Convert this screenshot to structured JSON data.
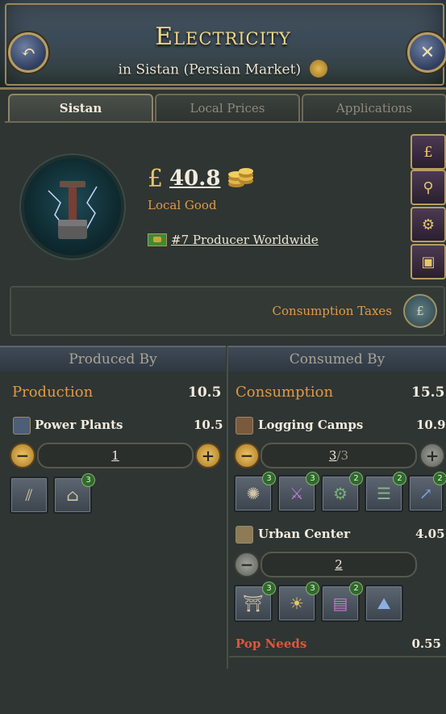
{
  "header": {
    "title": "Electricity",
    "subtitle_prefix": "in",
    "subtitle_location": "Sistan (Persian Market)"
  },
  "tabs": [
    {
      "label": "Sistan",
      "active": true
    },
    {
      "label": "Local Prices",
      "active": false
    },
    {
      "label": "Applications",
      "active": false
    }
  ],
  "good": {
    "currency_symbol": "£",
    "price": "40.8",
    "type_label": "Local Good",
    "rank_label": "#7 Producer Worldwide"
  },
  "taxes": {
    "label": "Consumption Taxes"
  },
  "columns": {
    "produced_header": "Produced By",
    "consumed_header": "Consumed By"
  },
  "produced": {
    "title": "Production",
    "total": "10.5",
    "rows": [
      {
        "name": "Power Plants",
        "value": "10.5",
        "stepper_value": "1",
        "buildings": [
          {
            "icon": "dam-icon",
            "badge": ""
          },
          {
            "icon": "government-icon",
            "badge": "3"
          }
        ]
      }
    ]
  },
  "consumed": {
    "title": "Consumption",
    "total": "15.5",
    "rows": [
      {
        "name": "Logging Camps",
        "value": "10.9",
        "stepper_current": "3",
        "stepper_max": "3",
        "buildings": [
          {
            "icon": "saw-blade-icon",
            "badge": "3"
          },
          {
            "icon": "chainsaw-icon",
            "badge": "3"
          },
          {
            "icon": "tool-gear-icon",
            "badge": "2"
          },
          {
            "icon": "rail-icon",
            "badge": "2"
          },
          {
            "icon": "growth-chart-icon",
            "badge": "2"
          }
        ]
      },
      {
        "name": "Urban Center",
        "value": "4.05",
        "stepper_value": "2",
        "buildings": [
          {
            "icon": "street-lamp-icon",
            "badge": "3"
          },
          {
            "icon": "light-bulb-icon",
            "badge": "3"
          },
          {
            "icon": "tram-icon",
            "badge": "2"
          },
          {
            "icon": "city-icon",
            "badge": ""
          }
        ]
      }
    ],
    "pop_needs_label": "Pop Needs",
    "pop_needs_value": "0.55"
  },
  "colors": {
    "accent_orange": "#e09a48",
    "gold": "#f1d98a",
    "pop_needs_red": "#e2553b"
  }
}
